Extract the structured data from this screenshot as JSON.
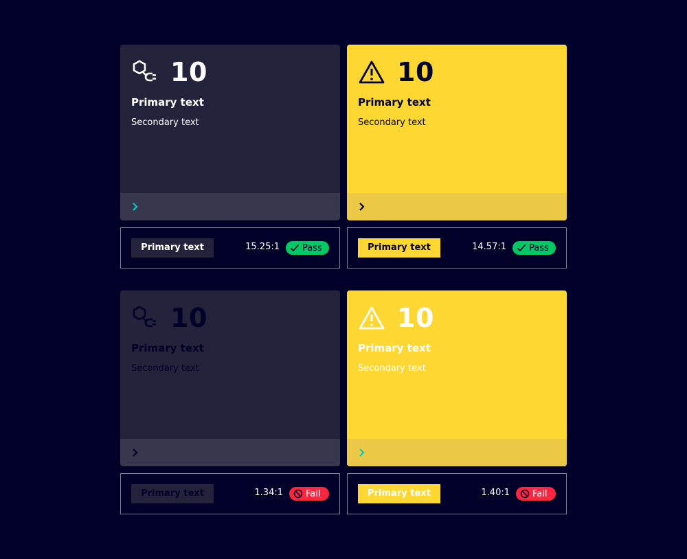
{
  "colors": {
    "background": "#000028",
    "dark_card": "#23233C",
    "dark_footer": "#37374D",
    "yellow_card": "#FFD732",
    "yellow_footer": "#EBC846",
    "pass": "#00C864",
    "fail": "#FF2640",
    "accent_chevron": "#00CCCC"
  },
  "cards": [
    {
      "icon": "plug-hexagon-icon",
      "value": "10",
      "primary": "Primary text",
      "secondary": "Secondary text",
      "chevron": "chevron-right-icon",
      "contrast": {
        "sample": "Primary text",
        "ratio": "15.25:1",
        "status": "Pass",
        "status_icon": "check-icon"
      }
    },
    {
      "icon": "warning-triangle-icon",
      "value": "10",
      "primary": "Primary text",
      "secondary": "Secondary text",
      "chevron": "chevron-right-icon",
      "contrast": {
        "sample": "Primary text",
        "ratio": "14.57:1",
        "status": "Pass",
        "status_icon": "check-icon"
      }
    },
    {
      "icon": "plug-hexagon-icon",
      "value": "10",
      "primary": "Primary text",
      "secondary": "Secondary text",
      "chevron": "chevron-right-icon",
      "contrast": {
        "sample": "Primary text",
        "ratio": "1.34:1",
        "status": "Fail",
        "status_icon": "prohibited-icon"
      }
    },
    {
      "icon": "warning-triangle-icon",
      "value": "10",
      "primary": "Primary text",
      "secondary": "Secondary text",
      "chevron": "chevron-right-icon",
      "contrast": {
        "sample": "Primary text",
        "ratio": "1.40:1",
        "status": "Fail",
        "status_icon": "prohibited-icon"
      }
    }
  ]
}
